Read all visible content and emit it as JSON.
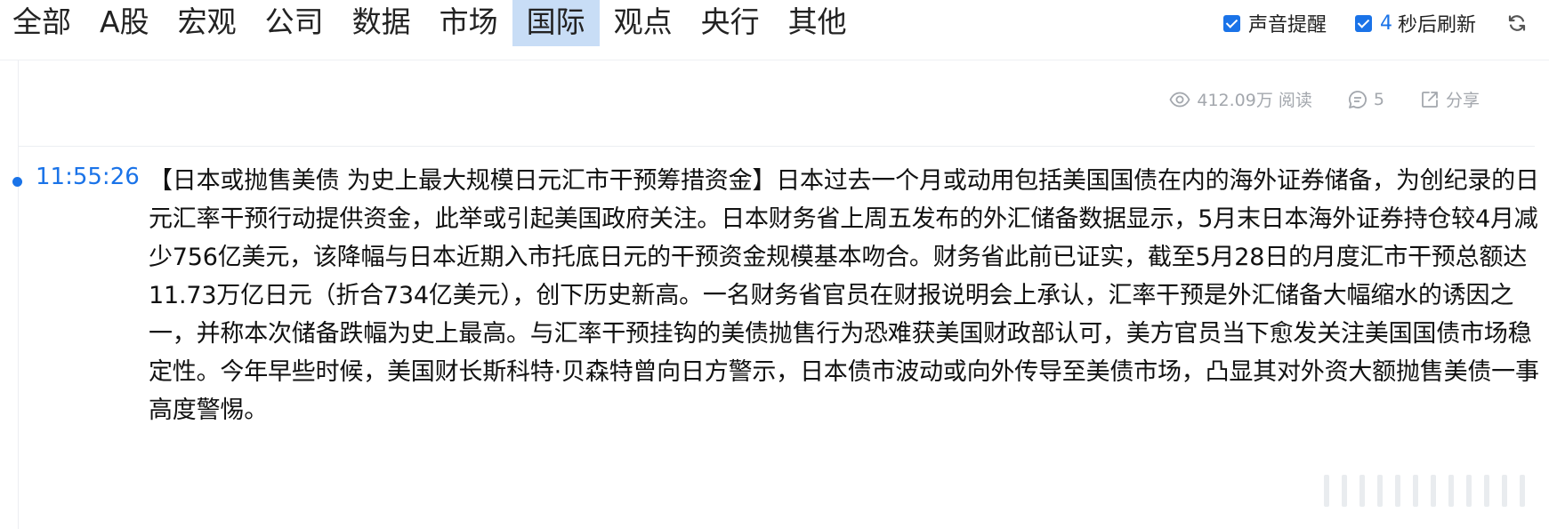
{
  "nav": {
    "tabs": [
      {
        "label": "全部",
        "active": false
      },
      {
        "label": "A股",
        "active": false
      },
      {
        "label": "宏观",
        "active": false
      },
      {
        "label": "公司",
        "active": false
      },
      {
        "label": "数据",
        "active": false
      },
      {
        "label": "市场",
        "active": false
      },
      {
        "label": "国际",
        "active": true
      },
      {
        "label": "观点",
        "active": false
      },
      {
        "label": "央行",
        "active": false
      },
      {
        "label": "其他",
        "active": false
      }
    ],
    "sound_alert": {
      "label": "声音提醒",
      "checked": true
    },
    "auto_refresh": {
      "seconds": "4",
      "label": "秒后刷新",
      "checked": true
    },
    "refresh_icon": "refresh-icon",
    "accent_color": "#1a73e8",
    "active_tab_bg": "#c8ddf6"
  },
  "prev_item": {
    "reads": "412.09万 阅读",
    "comments": "5",
    "share": "分享"
  },
  "news_item": {
    "time": "11:55:26",
    "headline": "【日本或抛售美债 为史上最大规模日元汇市干预筹措资金】",
    "body": "日本过去一个月或动用包括美国国债在内的海外证券储备，为创纪录的日元汇率干预行动提供资金，此举或引起美国政府关注。日本财务省上周五发布的外汇储备数据显示，5月末日本海外证券持仓较4月减少756亿美元，该降幅与日本近期入市托底日元的干预资金规模基本吻合。财务省此前已证实，截至5月28日的月度汇市干预总额达11.73万亿日元（折合734亿美元），创下历史新高。一名财务省官员在财报说明会上承认，汇率干预是外汇储备大幅缩水的诱因之一，并称本次储备跌幅为史上最高。与汇率干预挂钩的美债抛售行为恐难获美国财政部认可，美方官员当下愈发关注美国国债市场稳定性。今年早些时候，美国财长斯科特·贝森特曾向日方警示，日本债市波动或向外传导至美债市场，凸显其对外资大额抛售美债一事高度警惕。"
  }
}
